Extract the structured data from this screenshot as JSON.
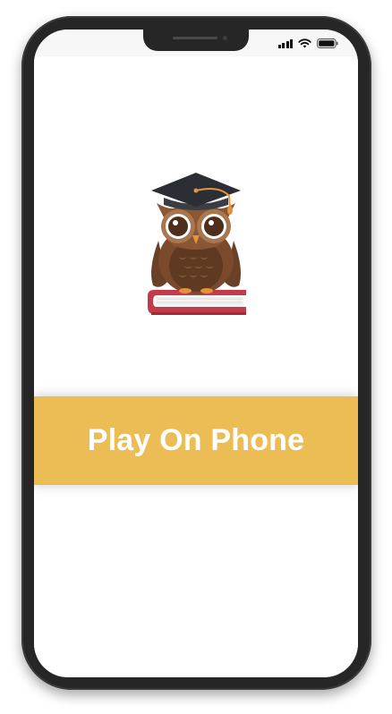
{
  "status_bar": {
    "icons": [
      "cellular-signal-icon",
      "wifi-icon",
      "battery-icon"
    ]
  },
  "hero": {
    "image": "owl-with-graduation-cap-on-book"
  },
  "play_button": {
    "label": "Play On Phone"
  },
  "colors": {
    "accent": "#ecbd55",
    "frame": "#262626",
    "screen_bg": "#ffffff",
    "status_bar_bg": "#f7f7f7"
  }
}
